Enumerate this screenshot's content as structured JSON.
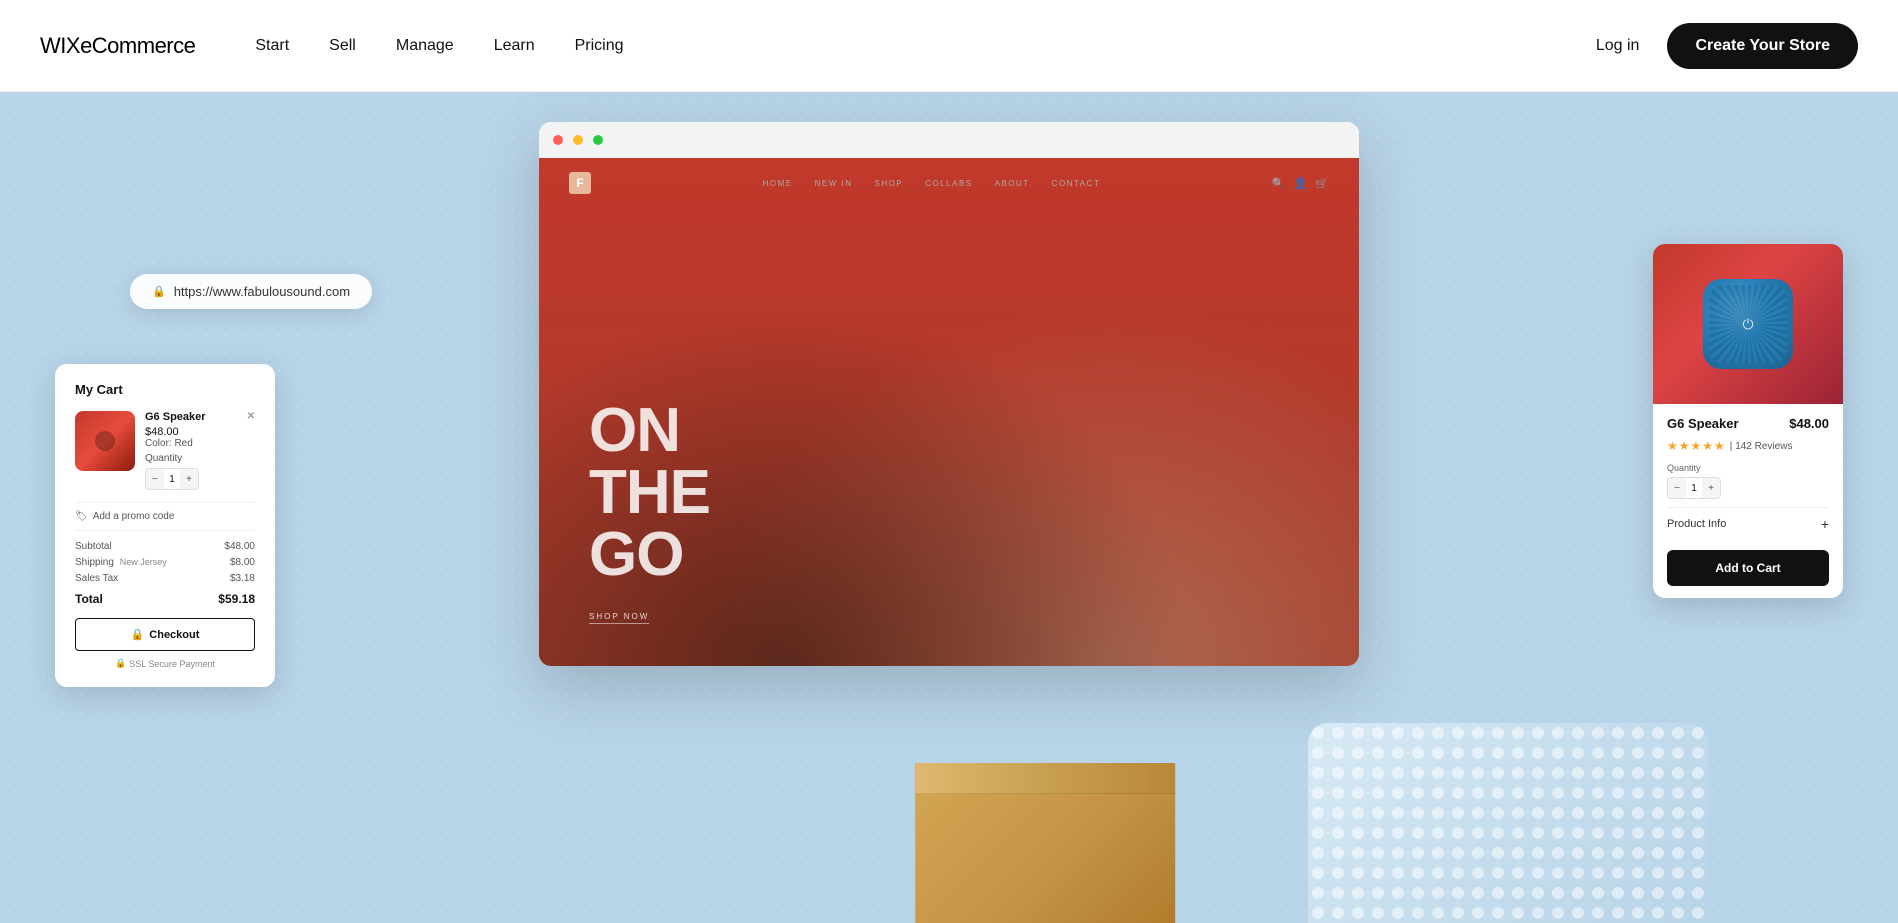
{
  "nav": {
    "logo_prefix": "WIX",
    "logo_suffix": "eCommerce",
    "links": [
      "Start",
      "Sell",
      "Manage",
      "Learn",
      "Pricing"
    ],
    "login_label": "Log in",
    "cta_label": "Create Your Store"
  },
  "hero": {
    "browser": {
      "store_nav_links": [
        "HOME",
        "NEW IN",
        "SHOP",
        "COLLABS",
        "ABOUT",
        "CONTACT"
      ],
      "hero_text_line1": "ON",
      "hero_text_line2": "THE",
      "hero_text_line3": "GO",
      "shop_now": "SHOP NOW"
    },
    "url_bar": {
      "url": "https://www.fabulousound.com"
    },
    "cart": {
      "title": "My Cart",
      "item_name": "G6 Speaker",
      "item_price": "$48.00",
      "item_color": "Color: Red",
      "item_qty_label": "Quantity",
      "item_qty": "1",
      "promo_label": "Add a promo code",
      "subtotal_label": "Subtotal",
      "subtotal_value": "$48.00",
      "shipping_label": "Shipping",
      "shipping_note": "New Jersey",
      "shipping_value": "$8.00",
      "tax_label": "Sales Tax",
      "tax_value": "$3.18",
      "total_label": "Total",
      "total_value": "$59.18",
      "checkout_label": "Checkout",
      "ssl_label": "SSL Secure Payment"
    },
    "product": {
      "name": "G6 Speaker",
      "price": "$48.00",
      "stars": "★★★★★",
      "stars_half": "★★★★☆",
      "reviews": "142 Reviews",
      "qty_label": "Quantity",
      "qty_value": "1",
      "info_label": "Product Info",
      "add_to_cart": "Add to Cart"
    }
  }
}
